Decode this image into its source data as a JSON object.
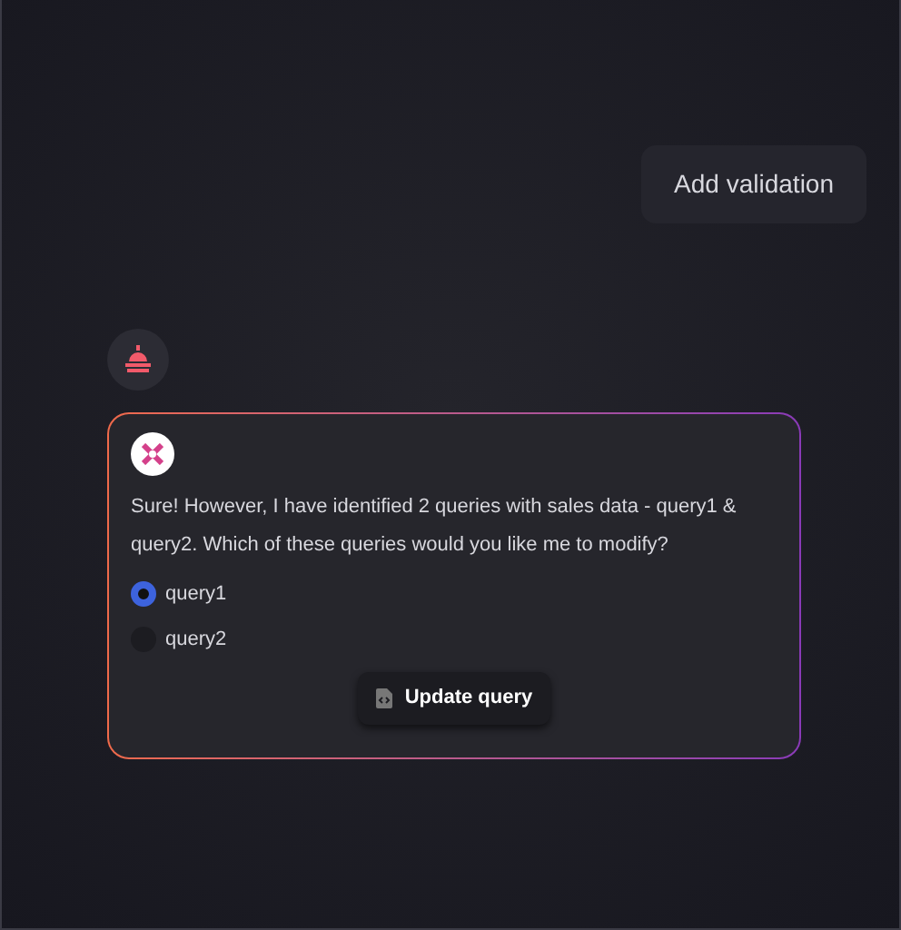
{
  "user_message": {
    "text": "Add validation"
  },
  "assistant_message": {
    "text": "Sure! However, I have identified 2 queries with sales data - query1 & query2. Which of these queries would you like me to modify?",
    "options": [
      {
        "label": "query1",
        "selected": true
      },
      {
        "label": "query2",
        "selected": false
      }
    ],
    "button": {
      "label": "Update query"
    }
  }
}
